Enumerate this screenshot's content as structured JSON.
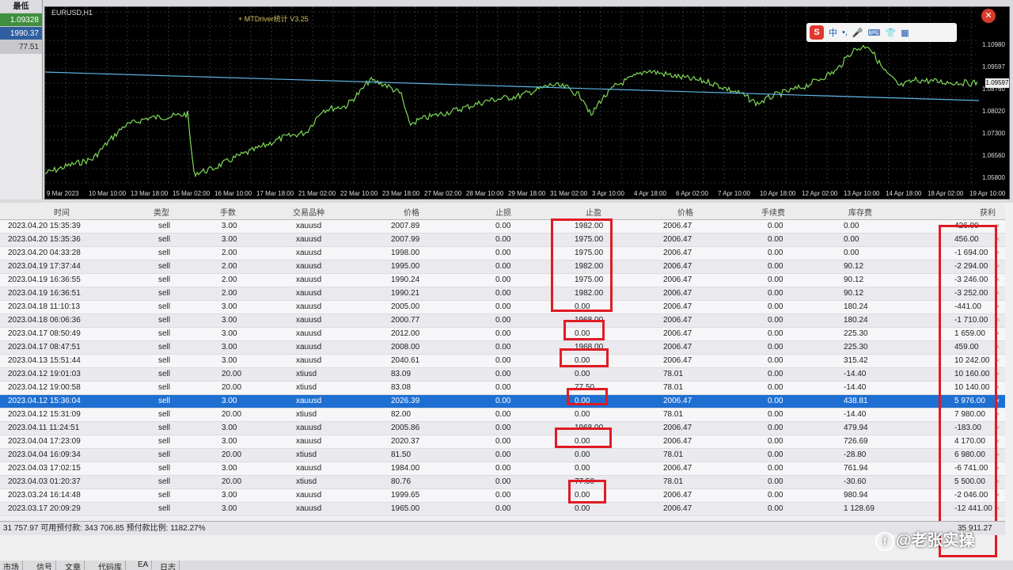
{
  "left_strip": {
    "header": "最低",
    "values": [
      "1.09328",
      "1990.37",
      "77.51"
    ]
  },
  "chart": {
    "title": "EURUSD,H1",
    "ea_label": "+ MTDriver统计 V3.25",
    "price_labels": [
      "1.10980",
      "1.09597",
      "1.08760",
      "1.08020",
      "1.07300",
      "1.06560",
      "1.05800"
    ],
    "price_tag": "1.09597",
    "x_labels": [
      "9 Mar 2023",
      "10 Mar 10:00",
      "13 Mar 18:00",
      "15 Mar 02:00",
      "16 Mar 10:00",
      "17 Mar 18:00",
      "21 Mar 02:00",
      "22 Mar 10:00",
      "23 Mar 18:00",
      "27 Mar 02:00",
      "28 Mar 10:00",
      "29 Mar 18:00",
      "31 Mar 02:00",
      "3 Apr 10:00",
      "4 Apr 18:00",
      "6 Apr 02:00",
      "7 Apr 10:00",
      "10 Apr 18:00",
      "12 Apr 02:00",
      "13 Apr 10:00",
      "14 Apr 18:00",
      "18 Apr 02:00",
      "19 Apr 10:00"
    ],
    "line_color": "#7ed957",
    "hline_color": "#5fb6e6"
  },
  "ime": {
    "logo": "S",
    "lang": "中"
  },
  "columns": {
    "time": "时间",
    "type": "类型",
    "volume": "手数",
    "symbol": "交易品种",
    "price": "价格",
    "sl": "止损",
    "tp": "止盈",
    "price2": "价格",
    "commission": "手续费",
    "swap": "库存费",
    "profit": "获利"
  },
  "rows": [
    {
      "time": "2023.04.20 15:35:39",
      "type": "sell",
      "volume": "3.00",
      "symbol": "xauusd",
      "price": "2007.89",
      "sl": "0.00",
      "tp": "1982.00",
      "price2": "2006.47",
      "commission": "0.00",
      "swap": "0.00",
      "profit": "426.00"
    },
    {
      "time": "2023.04.20 15:35:36",
      "type": "sell",
      "volume": "3.00",
      "symbol": "xauusd",
      "price": "2007.99",
      "sl": "0.00",
      "tp": "1975.00",
      "price2": "2006.47",
      "commission": "0.00",
      "swap": "0.00",
      "profit": "456.00"
    },
    {
      "time": "2023.04.20 04:33:28",
      "type": "sell",
      "volume": "2.00",
      "symbol": "xauusd",
      "price": "1998.00",
      "sl": "0.00",
      "tp": "1975.00",
      "price2": "2006.47",
      "commission": "0.00",
      "swap": "0.00",
      "profit": "-1 694.00"
    },
    {
      "time": "2023.04.19 17:37:44",
      "type": "sell",
      "volume": "2.00",
      "symbol": "xauusd",
      "price": "1995.00",
      "sl": "0.00",
      "tp": "1982.00",
      "price2": "2006.47",
      "commission": "0.00",
      "swap": "90.12",
      "profit": "-2 294.00"
    },
    {
      "time": "2023.04.19 16:36:55",
      "type": "sell",
      "volume": "2.00",
      "symbol": "xauusd",
      "price": "1990.24",
      "sl": "0.00",
      "tp": "1975.00",
      "price2": "2006.47",
      "commission": "0.00",
      "swap": "90.12",
      "profit": "-3 246.00"
    },
    {
      "time": "2023.04.19 16:36:51",
      "type": "sell",
      "volume": "2.00",
      "symbol": "xauusd",
      "price": "1990.21",
      "sl": "0.00",
      "tp": "1982.00",
      "price2": "2006.47",
      "commission": "0.00",
      "swap": "90.12",
      "profit": "-3 252.00"
    },
    {
      "time": "2023.04.18 11:10:13",
      "type": "sell",
      "volume": "3.00",
      "symbol": "xauusd",
      "price": "2005.00",
      "sl": "0.00",
      "tp": "0.00",
      "price2": "2006.47",
      "commission": "0.00",
      "swap": "180.24",
      "profit": "-441.00"
    },
    {
      "time": "2023.04.18 06:06:36",
      "type": "sell",
      "volume": "3.00",
      "symbol": "xauusd",
      "price": "2000.77",
      "sl": "0.00",
      "tp": "1968.00",
      "price2": "2006.47",
      "commission": "0.00",
      "swap": "180.24",
      "profit": "-1 710.00"
    },
    {
      "time": "2023.04.17 08:50:49",
      "type": "sell",
      "volume": "3.00",
      "symbol": "xauusd",
      "price": "2012.00",
      "sl": "0.00",
      "tp": "0.00",
      "price2": "2006.47",
      "commission": "0.00",
      "swap": "225.30",
      "profit": "1 659.00"
    },
    {
      "time": "2023.04.17 08:47:51",
      "type": "sell",
      "volume": "3.00",
      "symbol": "xauusd",
      "price": "2008.00",
      "sl": "0.00",
      "tp": "1968.00",
      "price2": "2006.47",
      "commission": "0.00",
      "swap": "225.30",
      "profit": "459.00"
    },
    {
      "time": "2023.04.13 15:51:44",
      "type": "sell",
      "volume": "3.00",
      "symbol": "xauusd",
      "price": "2040.61",
      "sl": "0.00",
      "tp": "0.00",
      "price2": "2006.47",
      "commission": "0.00",
      "swap": "315.42",
      "profit": "10 242.00"
    },
    {
      "time": "2023.04.12 19:01:03",
      "type": "sell",
      "volume": "20.00",
      "symbol": "xtiusd",
      "price": "83.09",
      "sl": "0.00",
      "tp": "0.00",
      "price2": "78.01",
      "commission": "0.00",
      "swap": "-14.40",
      "profit": "10 160.00"
    },
    {
      "time": "2023.04.12 19:00:58",
      "type": "sell",
      "volume": "20.00",
      "symbol": "xtiusd",
      "price": "83.08",
      "sl": "0.00",
      "tp": "77.50",
      "price2": "78.01",
      "commission": "0.00",
      "swap": "-14.40",
      "profit": "10 140.00"
    },
    {
      "time": "2023.04.12 15:36:04",
      "type": "sell",
      "volume": "3.00",
      "symbol": "xauusd",
      "price": "2026.39",
      "sl": "0.00",
      "tp": "0.00",
      "price2": "2006.47",
      "commission": "0.00",
      "swap": "438.81",
      "profit": "5 976.00",
      "selected": true
    },
    {
      "time": "2023.04.12 15:31:09",
      "type": "sell",
      "volume": "20.00",
      "symbol": "xtiusd",
      "price": "82.00",
      "sl": "0.00",
      "tp": "0.00",
      "price2": "78.01",
      "commission": "0.00",
      "swap": "-14.40",
      "profit": "7 980.00"
    },
    {
      "time": "2023.04.11 11:24:51",
      "type": "sell",
      "volume": "3.00",
      "symbol": "xauusd",
      "price": "2005.86",
      "sl": "0.00",
      "tp": "1968.00",
      "price2": "2006.47",
      "commission": "0.00",
      "swap": "479.94",
      "profit": "-183.00"
    },
    {
      "time": "2023.04.04 17:23:09",
      "type": "sell",
      "volume": "3.00",
      "symbol": "xauusd",
      "price": "2020.37",
      "sl": "0.00",
      "tp": "0.00",
      "price2": "2006.47",
      "commission": "0.00",
      "swap": "726.69",
      "profit": "4 170.00"
    },
    {
      "time": "2023.04.04 16:09:34",
      "type": "sell",
      "volume": "20.00",
      "symbol": "xtiusd",
      "price": "81.50",
      "sl": "0.00",
      "tp": "0.00",
      "price2": "78.01",
      "commission": "0.00",
      "swap": "-28.80",
      "profit": "6 980.00"
    },
    {
      "time": "2023.04.03 17:02:15",
      "type": "sell",
      "volume": "3.00",
      "symbol": "xauusd",
      "price": "1984.00",
      "sl": "0.00",
      "tp": "0.00",
      "price2": "2006.47",
      "commission": "0.00",
      "swap": "761.94",
      "profit": "-6 741.00"
    },
    {
      "time": "2023.04.03 01:20:37",
      "type": "sell",
      "volume": "20.00",
      "symbol": "xtiusd",
      "price": "80.76",
      "sl": "0.00",
      "tp": "77.50",
      "price2": "78.01",
      "commission": "0.00",
      "swap": "-30.60",
      "profit": "5 500.00"
    },
    {
      "time": "2023.03.24 16:14:48",
      "type": "sell",
      "volume": "3.00",
      "symbol": "xauusd",
      "price": "1999.65",
      "sl": "0.00",
      "tp": "0.00",
      "price2": "2006.47",
      "commission": "0.00",
      "swap": "980.94",
      "profit": "-2 046.00"
    },
    {
      "time": "2023.03.17 20:09:29",
      "type": "sell",
      "volume": "3.00",
      "symbol": "xauusd",
      "price": "1965.00",
      "sl": "0.00",
      "tp": "0.00",
      "price2": "2006.47",
      "commission": "0.00",
      "swap": "1 128.69",
      "profit": "-12 441.00"
    }
  ],
  "footer": {
    "text": "31 757.97  可用预付款: 343 706.85  预付款比例: 1182.27%",
    "total": "35 911.27"
  },
  "tabs": [
    "市场",
    "信号",
    "文章",
    "代码库",
    "EA",
    "日志"
  ],
  "watermark": "@老张实操",
  "highlight_color": "#e01b24"
}
